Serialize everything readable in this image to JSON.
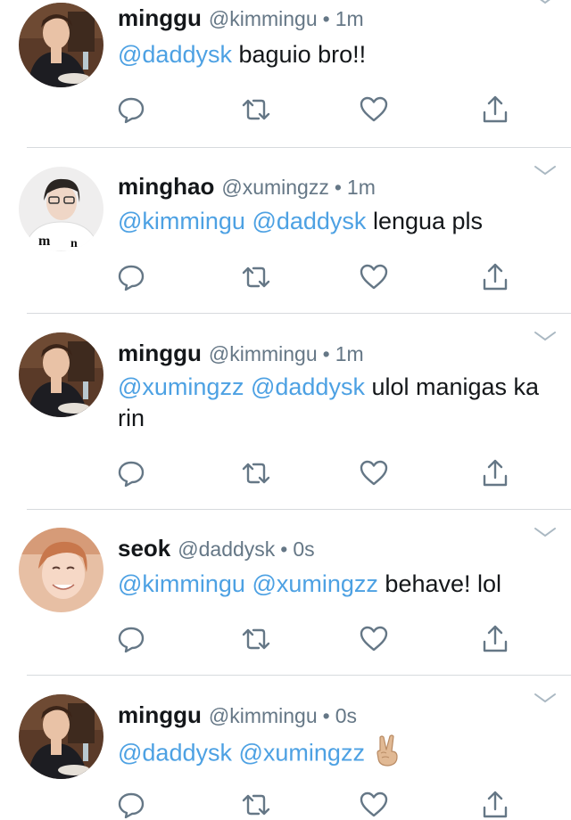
{
  "colors": {
    "mention": "#4da1e3",
    "meta": "#657786",
    "icon": "#657786",
    "divider": "#d7dadd"
  },
  "icons": [
    "reply-icon",
    "retweet-icon",
    "like-icon",
    "share-icon",
    "chevron-down-icon"
  ],
  "tweets": [
    {
      "name": "minggu",
      "handle": "@kimmingu",
      "sep": "•",
      "time": "1m",
      "mentions": [
        "@daddysk"
      ],
      "text": "baguio bro!!"
    },
    {
      "name": "minghao",
      "handle": "@xumingzz",
      "sep": "•",
      "time": "1m",
      "mentions": [
        "@kimmingu",
        "@daddysk"
      ],
      "text": "lengua pls"
    },
    {
      "name": "minggu",
      "handle": "@kimmingu",
      "sep": "•",
      "time": "1m",
      "mentions": [
        "@xumingzz",
        "@daddysk"
      ],
      "text": "ulol manigas ka rin"
    },
    {
      "name": "seok",
      "handle": "@daddysk",
      "sep": "•",
      "time": "0s",
      "mentions": [
        "@kimmingu",
        "@xumingzz"
      ],
      "text": "behave! lol"
    },
    {
      "name": "minggu",
      "handle": "@kimmingu",
      "sep": "•",
      "time": "0s",
      "mentions": [
        "@daddysk",
        "@xumingzz"
      ],
      "text": "",
      "emoji": "victory-hand-emoji"
    }
  ]
}
